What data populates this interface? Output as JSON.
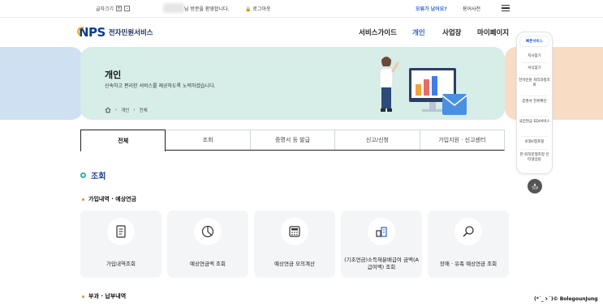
{
  "util": {
    "font_size_label": "글자크기",
    "plus": "+",
    "minus": "-",
    "welcome": "님 방문을 환영합니다.",
    "logout": "로그아웃",
    "forgot": "오류가 났어요?",
    "dictionary": "용어사전"
  },
  "header": {
    "logo_mark": "NPS",
    "logo_text": "전자민원서비스",
    "nav": [
      "서비스가이드",
      "개인",
      "사업장",
      "마이페이지"
    ],
    "active_nav": "개인",
    "active_color": "#2a5fd8"
  },
  "banner": {
    "title": "개인",
    "subtitle": "신속하고 편리한 서비스를 제공하도록 노력하겠습니다.",
    "breadcrumb": [
      "개인",
      "전체"
    ]
  },
  "tabs": [
    "전체",
    "조회",
    "증명서 등 발급",
    "신고/신청",
    "가입지원 · 신고센터"
  ],
  "active_tab": "전체",
  "section": {
    "title": "조회",
    "group1": "가입내역 · 예상연금",
    "group2": "부과 · 납부내역",
    "cards": [
      {
        "label": "가입내역조회",
        "icon": "document-icon"
      },
      {
        "label": "예상연금액 조회",
        "icon": "pie-chart-icon"
      },
      {
        "label": "예상연금 모의계산",
        "icon": "calculator-icon"
      },
      {
        "label": "(기초연금)소득재분배급여 금액(A급여액) 조회",
        "icon": "building-icon"
      },
      {
        "label": "장애 · 유족 예상연금 조회",
        "icon": "search-icon"
      }
    ]
  },
  "quick_menu": {
    "title": "빠른서비스",
    "items": [
      "지사찾기",
      "서식찾기",
      "전자민원 처리과정조회",
      "증명서 진위확인",
      "국민연금 EDI서비스",
      "4대보험포털",
      "한·퇴직분쟁조정 인터넷상담"
    ],
    "top": "TOP"
  },
  "watermark": "(*´_ゝ`)© BolegounJung"
}
